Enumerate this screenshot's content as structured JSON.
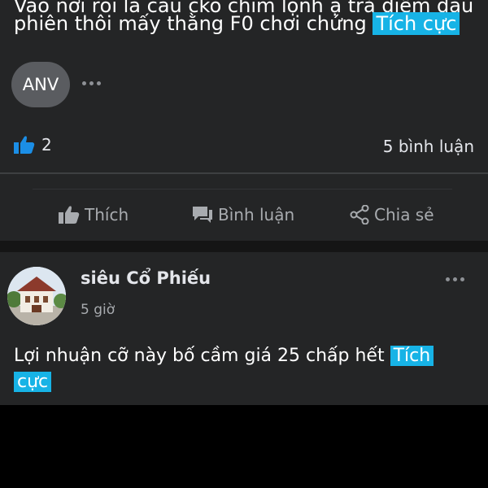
{
  "post1": {
    "text_line1": "Vào nơi rồi là cầu cko chim lộnh ạ trả điểm đầu",
    "text_line2": "phiên thôi mấy thằng F0 chơi chứng",
    "tag": "Tích cực",
    "commenter_initials": "ANV",
    "like_count": "2",
    "comment_count": "5 bình luận",
    "actions": {
      "like": "Thích",
      "comment": "Bình luận",
      "share": "Chia sẻ"
    }
  },
  "post2": {
    "author": "siêu Cổ Phiếu",
    "time": "5 giờ",
    "text": "Lợi nhuận cỡ này bố cầm giá 25 chấp hết",
    "tag_part1": "Tích",
    "tag_part2": "cực"
  },
  "colors": {
    "tag": "#17b3e6",
    "like_blue": "#1b8ee6",
    "card": "#242526"
  }
}
